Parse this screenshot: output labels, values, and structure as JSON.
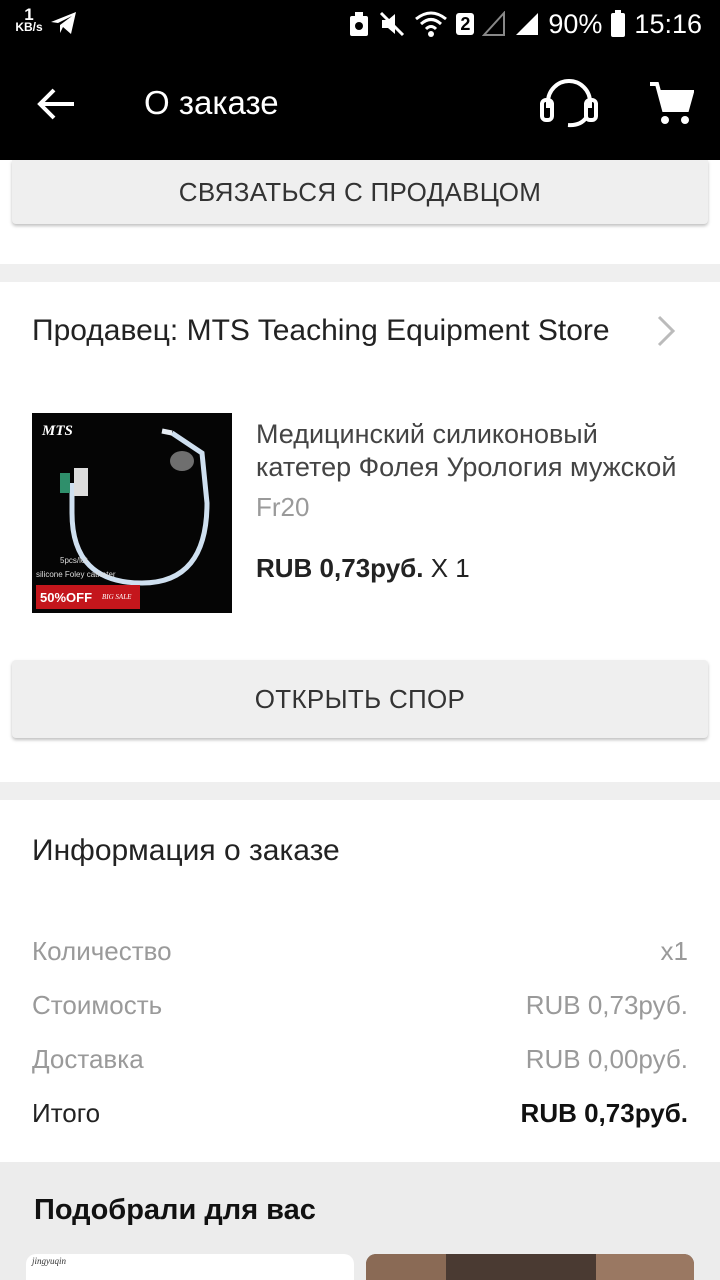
{
  "status_bar": {
    "speed_value": "1",
    "speed_unit": "KB/s",
    "sim_badge": "2",
    "battery": "90%",
    "time": "15:16"
  },
  "app_bar": {
    "title": "О заказе",
    "icons": [
      "back-arrow-icon",
      "headset-icon",
      "cart-icon"
    ]
  },
  "contact_seller_button": "СВЯЗАТЬСЯ С ПРОДАВЦОМ",
  "seller": {
    "label": "Продавец: MTS Teaching Equipment Store"
  },
  "product": {
    "image_text": {
      "brand": "MTS",
      "pack": "5pcs/lot",
      "name": "silicone Foley catheter",
      "discount": "50%OFF",
      "sale": "BIG SALE"
    },
    "title_line1": "Медицинский силиконовый",
    "title_line2": "катетер Фолея Урология мужской",
    "variant": "Fr20",
    "price": "RUB 0,73руб.",
    "quantity": "X 1"
  },
  "open_dispute_button": "ОТКРЫТЬ СПОР",
  "order_info": {
    "title": "Информация о заказе",
    "rows": [
      {
        "label": "Количество",
        "value": "x1"
      },
      {
        "label": "Стоимость",
        "value": "RUB 0,73руб."
      },
      {
        "label": "Доставка",
        "value": "RUB 0,00руб."
      },
      {
        "label": "Итого",
        "value": "RUB 0,73руб."
      }
    ]
  },
  "recommendations": {
    "title": "Подобрали для вас",
    "first_card_brand": "jingyuqin"
  }
}
